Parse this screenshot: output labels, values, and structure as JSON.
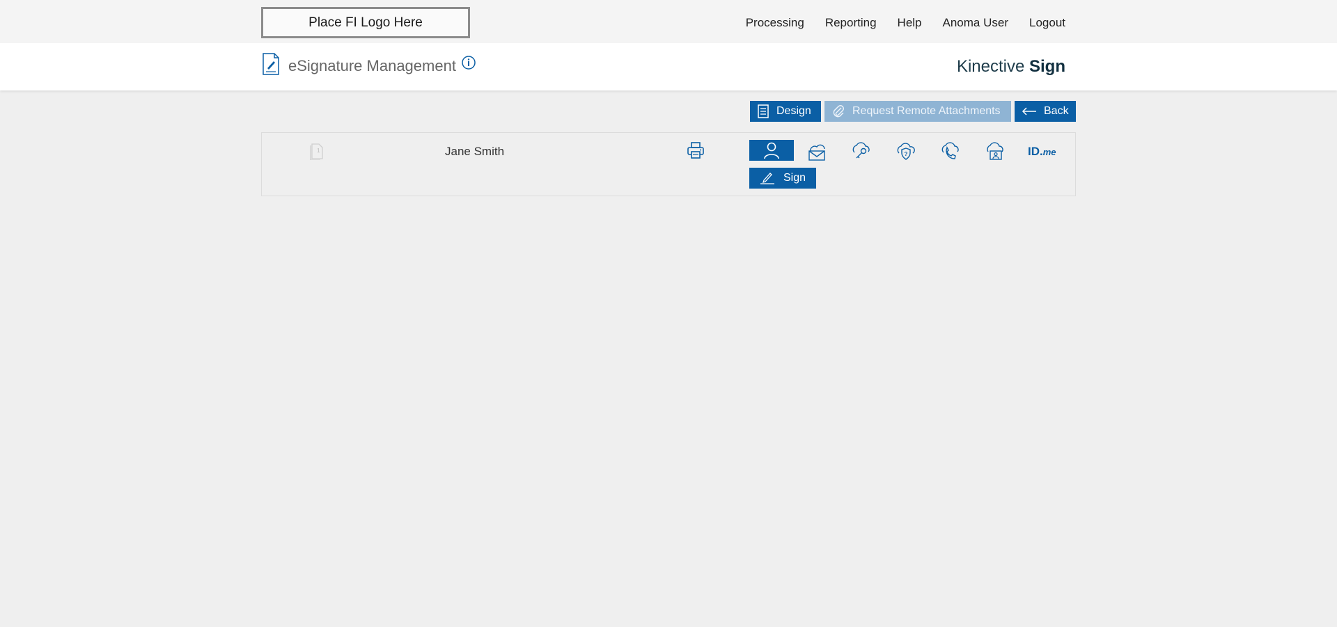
{
  "header": {
    "logo_text": "Place FI Logo Here",
    "nav": [
      {
        "label": "Processing"
      },
      {
        "label": "Reporting"
      },
      {
        "label": "Help"
      },
      {
        "label": "Anoma User"
      },
      {
        "label": "Logout"
      }
    ]
  },
  "subheader": {
    "title": "eSignature Management",
    "brand_light": "Kinective ",
    "brand_bold": "Sign"
  },
  "actions": {
    "design_label": "Design",
    "request_label": "Request Remote Attachments",
    "back_label": "Back"
  },
  "signer_row": {
    "doc_page_number": "1",
    "name": "Jane Smith",
    "auth_methods": [
      "person-icon",
      "cloud-mail-icon",
      "cloud-key-icon",
      "cloud-shield-question-icon",
      "cloud-phone-icon",
      "cloud-id-card-icon",
      "idme-logo"
    ],
    "idme_text": "ID.",
    "idme_suffix": "me",
    "sign_label": "Sign"
  },
  "colors": {
    "accent": "#0b5fa5",
    "accent_disabled": "#8fb4d4",
    "top_bar": "#f4f4f4",
    "background": "#efefef"
  }
}
